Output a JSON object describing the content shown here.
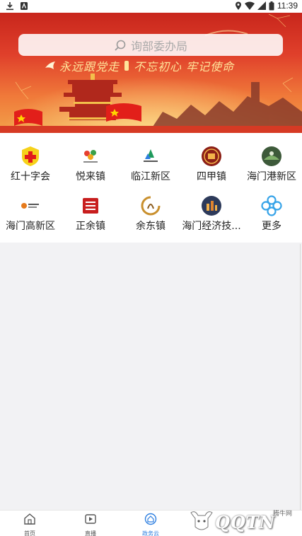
{
  "status_bar": {
    "time": "11:39"
  },
  "search": {
    "placeholder": "询部委办局"
  },
  "banner": {
    "slogan_left": "永远跟党走",
    "slogan_right": "不忘初心  牢记使命"
  },
  "grid": {
    "items": [
      {
        "label": "红十字会",
        "icon": "red-cross-icon"
      },
      {
        "label": "悦来镇",
        "icon": "yuelai-logo-icon"
      },
      {
        "label": "临江新区",
        "icon": "linjiang-logo-icon"
      },
      {
        "label": "四甲镇",
        "icon": "sijia-logo-icon"
      },
      {
        "label": "海门港新区",
        "icon": "haimen-port-logo-icon"
      },
      {
        "label": "海门高新区",
        "icon": "haimen-hitech-logo-icon"
      },
      {
        "label": "正余镇",
        "icon": "zhengyu-logo-icon"
      },
      {
        "label": "余东镇",
        "icon": "yudong-logo-icon"
      },
      {
        "label": "海门经济技...",
        "icon": "haimen-econ-logo-icon"
      },
      {
        "label": "更多",
        "icon": "more-icon"
      }
    ]
  },
  "bottom_nav": {
    "items": [
      {
        "label": "首页",
        "icon": "home-icon",
        "active": false
      },
      {
        "label": "直播",
        "icon": "live-icon",
        "active": false
      },
      {
        "label": "政务云",
        "icon": "cloud-gov-icon",
        "active": true
      }
    ]
  },
  "watermark": {
    "logo_text": "QQTN",
    "site_text": "腾牛网"
  },
  "colors": {
    "accent": "#2e7fe0",
    "banner_red": "#d8331f",
    "more_blue": "#36a3e8"
  }
}
